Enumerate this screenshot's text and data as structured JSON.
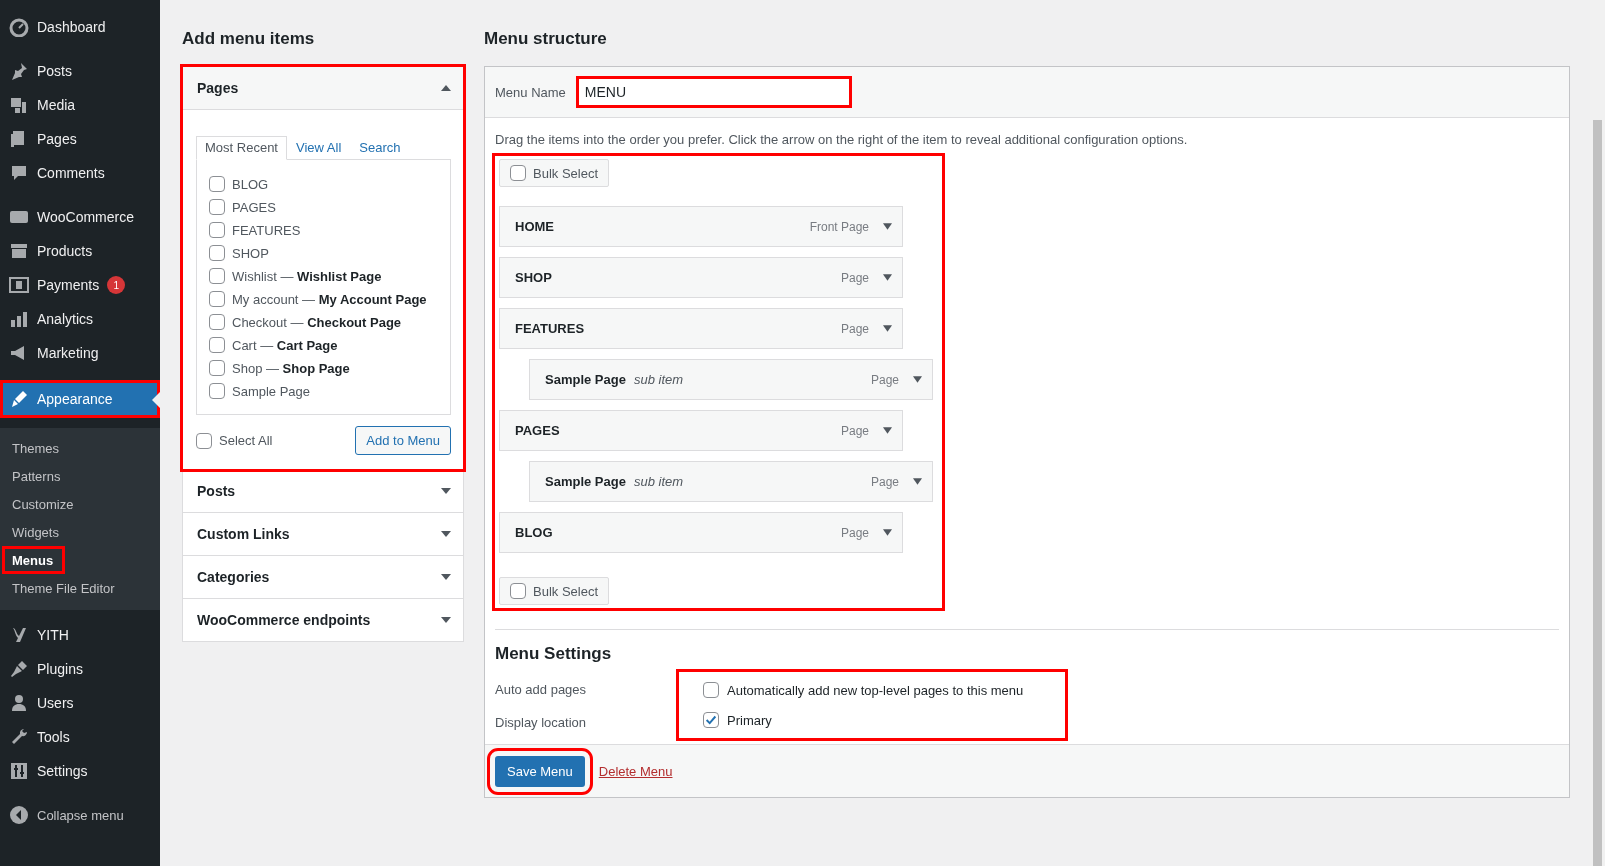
{
  "sidebar": {
    "groups": [
      [
        {
          "label": "Dashboard",
          "selected": false
        }
      ],
      [
        {
          "label": "Posts",
          "selected": false
        },
        {
          "label": "Media",
          "selected": false
        },
        {
          "label": "Pages",
          "selected": false
        },
        {
          "label": "Comments",
          "selected": false
        }
      ],
      [
        {
          "label": "WooCommerce",
          "selected": false
        },
        {
          "label": "Products",
          "selected": false
        },
        {
          "label": "Payments",
          "selected": false,
          "badge": "1"
        },
        {
          "label": "Analytics",
          "selected": false
        },
        {
          "label": "Marketing",
          "selected": false
        }
      ],
      [
        {
          "label": "Appearance",
          "selected": true,
          "children": [
            {
              "label": "Themes",
              "selected": false
            },
            {
              "label": "Patterns",
              "selected": false
            },
            {
              "label": "Customize",
              "selected": false
            },
            {
              "label": "Widgets",
              "selected": false
            },
            {
              "label": "Menus",
              "selected": true
            },
            {
              "label": "Theme File Editor",
              "selected": false
            }
          ]
        },
        {
          "label": "YITH",
          "selected": false
        },
        {
          "label": "Plugins",
          "selected": false
        },
        {
          "label": "Users",
          "selected": false
        },
        {
          "label": "Tools",
          "selected": false
        },
        {
          "label": "Settings",
          "selected": false
        }
      ]
    ],
    "collapse_label": "Collapse menu"
  },
  "add_menu_items": {
    "title": "Add menu items",
    "sections": [
      {
        "title": "Pages",
        "expanded": true,
        "tabs": [
          {
            "label": "Most Recent",
            "selected": true
          },
          {
            "label": "View All",
            "selected": false
          },
          {
            "label": "Search",
            "selected": false
          }
        ],
        "pages": [
          {
            "label": "BLOG",
            "checked": false
          },
          {
            "label": "PAGES",
            "checked": false
          },
          {
            "label": "FEATURES",
            "checked": false
          },
          {
            "label": "SHOP",
            "checked": false
          },
          {
            "label": "Wishlist — **Wishlist Page**",
            "checked": false
          },
          {
            "label": "My account — **My Account Page**",
            "checked": false
          },
          {
            "label": "Checkout — **Checkout Page**",
            "checked": false
          },
          {
            "label": "Cart — **Cart Page**",
            "checked": false
          },
          {
            "label": "Shop — **Shop Page**",
            "checked": false
          },
          {
            "label": "Sample Page",
            "checked": false
          }
        ],
        "select_all": {
          "label": "Select All",
          "checked": false
        },
        "add_button": "Add to Menu"
      },
      {
        "title": "Posts",
        "expanded": false
      },
      {
        "title": "Custom Links",
        "expanded": false
      },
      {
        "title": "Categories",
        "expanded": false
      },
      {
        "title": "WooCommerce endpoints",
        "expanded": false
      }
    ]
  },
  "menu_structure": {
    "title": "Menu structure",
    "name_label": "Menu Name",
    "name_value": "MENU",
    "instructions": "Drag the items into the order you prefer. Click the arrow on the right of the item to reveal additional configuration options.",
    "bulk_select_top": {
      "label": "Bulk Select",
      "checked": false
    },
    "items": [
      {
        "title": "HOME",
        "type": "Front Page"
      },
      {
        "title": "SHOP",
        "type": "Page"
      },
      {
        "title": "FEATURES",
        "type": "Page",
        "children": [
          {
            "title": "Sample Page",
            "note": "sub item",
            "type": "Page"
          }
        ]
      },
      {
        "title": "PAGES",
        "type": "Page",
        "children": [
          {
            "title": "Sample Page",
            "note": "sub item",
            "type": "Page"
          }
        ]
      },
      {
        "title": "BLOG",
        "type": "Page"
      }
    ],
    "bulk_select_bottom": {
      "label": "Bulk Select",
      "checked": false
    },
    "settings": {
      "title": "Menu Settings",
      "rows": [
        {
          "label": "Auto add pages",
          "option": "Automatically add new top-level pages to this menu",
          "checked": false
        },
        {
          "label": "Display location",
          "option": "Primary",
          "checked": true
        }
      ]
    },
    "save_button": "Save Menu",
    "delete_link": "Delete Menu"
  }
}
